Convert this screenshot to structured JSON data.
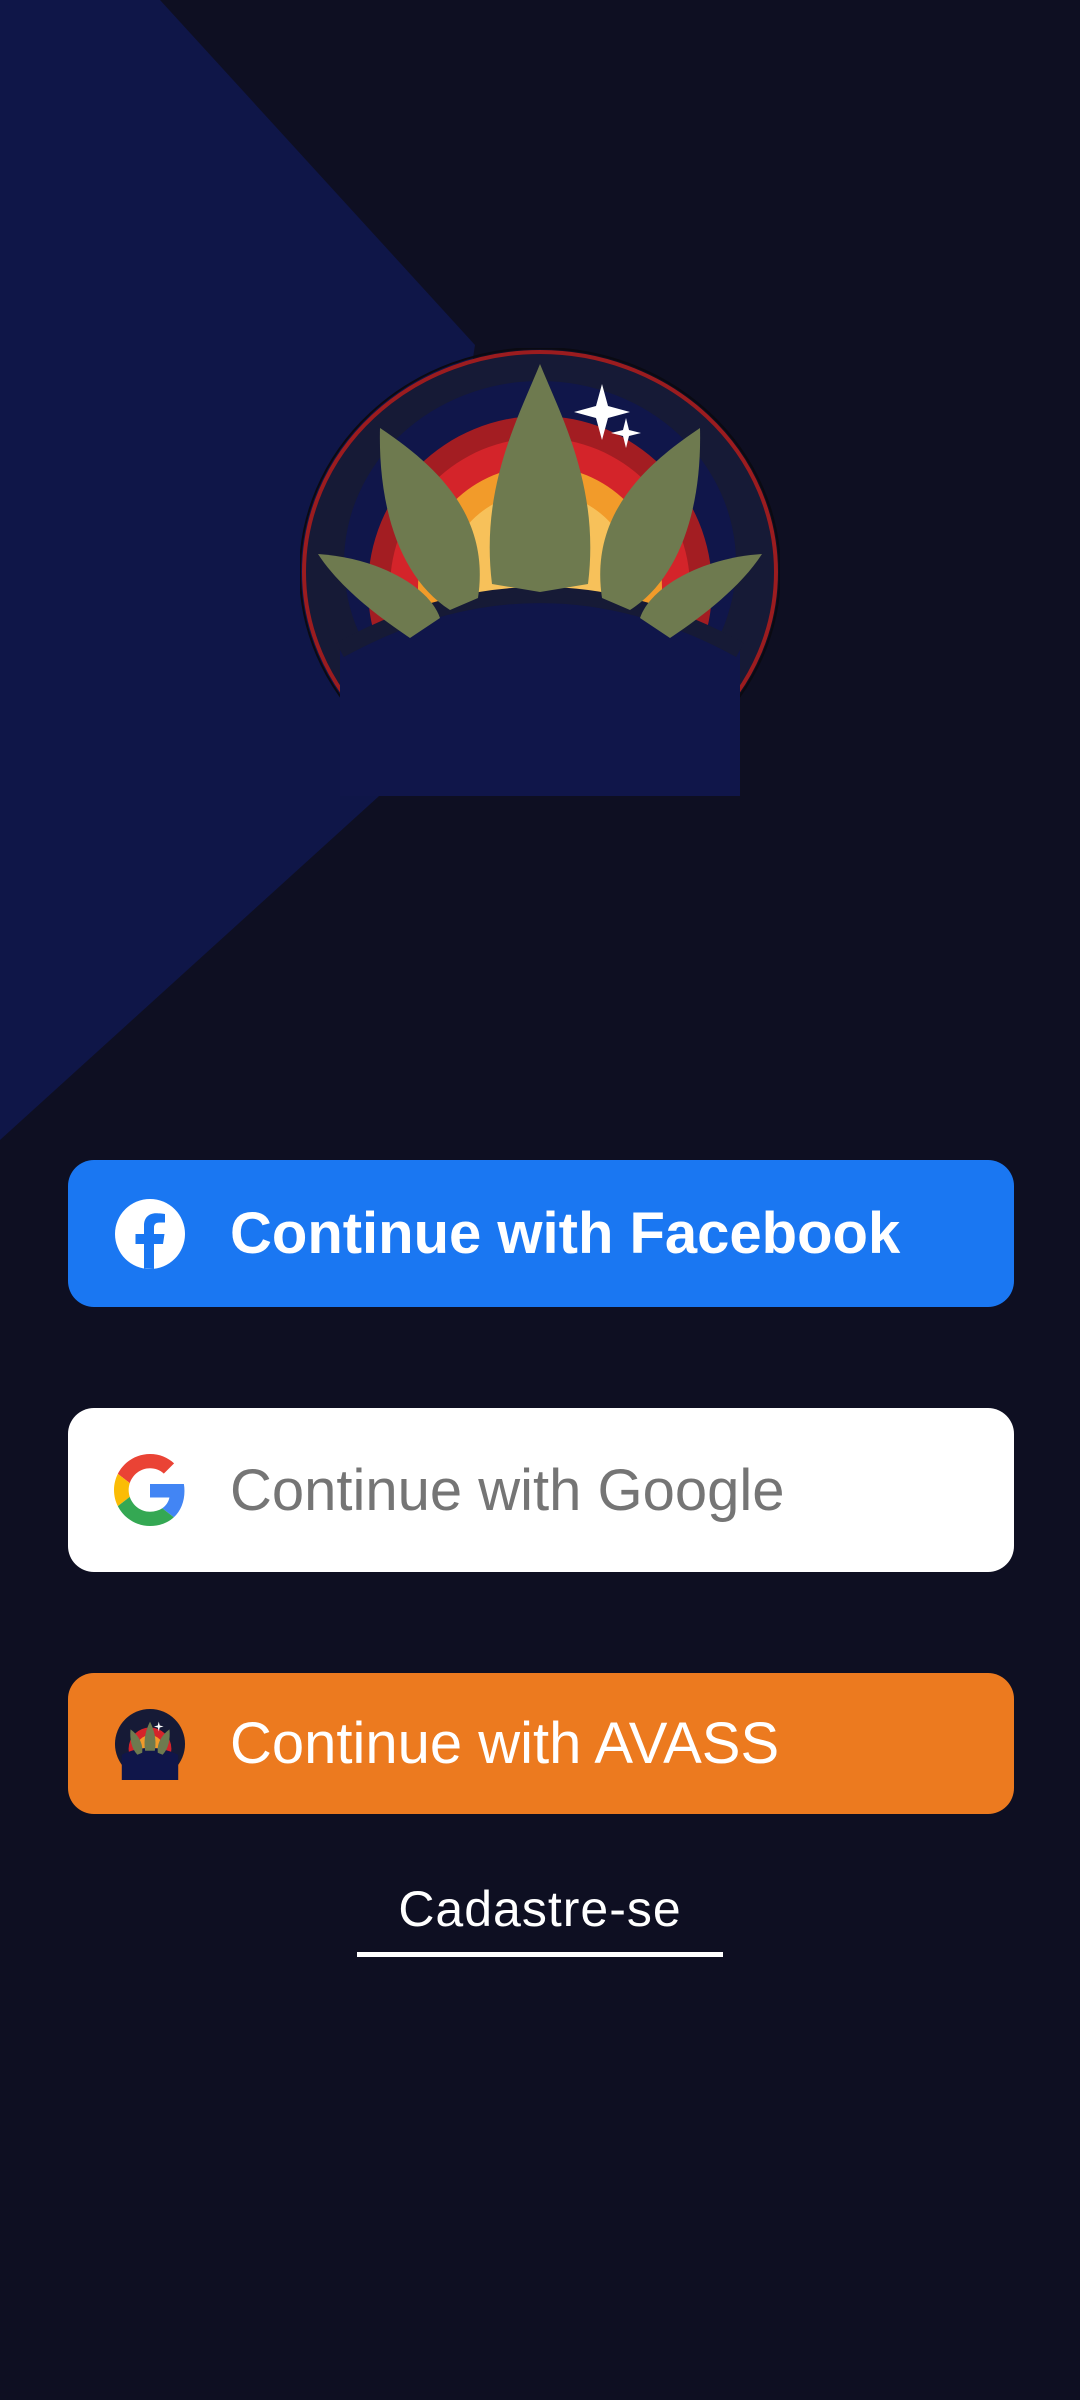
{
  "buttons": {
    "facebook": {
      "label": "Continue with Facebook",
      "color": "#1a77f2"
    },
    "google": {
      "label": "Continue with Google",
      "color": "#ffffff"
    },
    "avass": {
      "label": "Continue with AVASS",
      "color": "#ec7a1f"
    }
  },
  "signup": {
    "label": "Cadastre-se"
  },
  "icons": {
    "facebook": "facebook-icon",
    "google": "google-icon",
    "avass": "avass-logo-icon",
    "app_logo": "avass-logo"
  },
  "theme": {
    "background": "#0e0f22",
    "accent_blue": "#0f1648"
  }
}
